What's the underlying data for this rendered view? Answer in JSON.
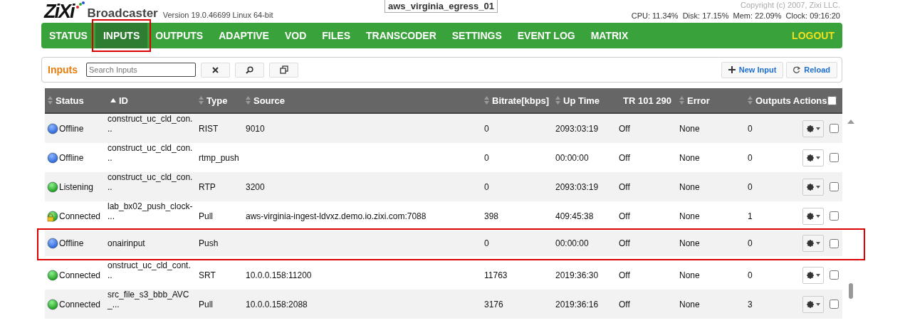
{
  "header": {
    "logo": "ZiXi",
    "product": "Broadcaster",
    "version": "Version 19.0.46699 Linux 64-bit",
    "server_name": "aws_virginia_egress_01",
    "copyright": "Copyright (c) 2007, Zixi LLC.",
    "stats": "CPU: 11.34%  Disk: 17.15%  Mem: 22.09%  Clock: 09:16:20"
  },
  "nav": [
    {
      "label": "STATUS",
      "selected": false,
      "highlighted": false
    },
    {
      "label": "INPUTS",
      "selected": true,
      "highlighted": true
    },
    {
      "label": "OUTPUTS",
      "selected": false,
      "highlighted": false
    },
    {
      "label": "ADAPTIVE",
      "selected": false,
      "highlighted": false
    },
    {
      "label": "VOD",
      "selected": false,
      "highlighted": false
    },
    {
      "label": "FILES",
      "selected": false,
      "highlighted": false
    },
    {
      "label": "TRANSCODER",
      "selected": false,
      "highlighted": false
    },
    {
      "label": "SETTINGS",
      "selected": false,
      "highlighted": false
    },
    {
      "label": "EVENT LOG",
      "selected": false,
      "highlighted": false
    },
    {
      "label": "MATRIX",
      "selected": false,
      "highlighted": false
    }
  ],
  "logout": "LOGOUT",
  "toolbar": {
    "title": "Inputs",
    "search": {
      "placeholder": "Search Inputs"
    },
    "new_button": "New Input",
    "reload_button": "Reload"
  },
  "table": {
    "columns": [
      {
        "label": "Status",
        "sortable": true,
        "sorted_ascending": false
      },
      {
        "label": "ID",
        "sortable": true,
        "sorted_ascending": true
      },
      {
        "label": "Type",
        "sortable": true,
        "sorted_ascending": false
      },
      {
        "label": "Source",
        "sortable": true,
        "sorted_ascending": false
      },
      {
        "label": "Bitrate[kbps]",
        "sortable": true,
        "sorted_ascending": false
      },
      {
        "label": "Up Time",
        "sortable": true,
        "sorted_ascending": false
      },
      {
        "label": "TR 101 290",
        "sortable": false
      },
      {
        "label": "Error",
        "sortable": true,
        "sorted_ascending": false
      },
      {
        "label": "Outputs",
        "sortable": true,
        "sorted_ascending": false
      },
      {
        "label": "Actions",
        "sortable": false
      }
    ],
    "select_all": {
      "checked": false
    },
    "rows": [
      {
        "kind": "offline",
        "status": "Offline",
        "id": "construct_uc_cld_con.\n..",
        "type": "RIST",
        "source": "9010",
        "bitrate": "0",
        "uptime": "2093:03:19",
        "tr": "Off",
        "error": "None",
        "outputs": "0",
        "checked": false,
        "highlighted": false
      },
      {
        "kind": "offline",
        "status": "Offline",
        "id": "construct_uc_cld_con.\n..",
        "type": "rtmp_push",
        "source": "",
        "bitrate": "0",
        "uptime": "00:00:00",
        "tr": "Off",
        "error": "None",
        "outputs": "0",
        "checked": false,
        "highlighted": false
      },
      {
        "kind": "online",
        "status": "Listening",
        "id": "construct_uc_cld_con.\n..",
        "type": "RTP",
        "source": "3200",
        "bitrate": "0",
        "uptime": "2093:03:19",
        "tr": "Off",
        "error": "None",
        "outputs": "0",
        "checked": false,
        "highlighted": false
      },
      {
        "kind": "secure",
        "status": "Connected",
        "id": "lab_bx02_push_clock-\n...",
        "type": "Pull",
        "source": "aws-virginia-ingest-ldvxz.demo.io.zixi.com:7088",
        "bitrate": "398",
        "uptime": "409:45:38",
        "tr": "Off",
        "error": "None",
        "outputs": "1",
        "checked": false,
        "highlighted": false
      },
      {
        "kind": "offline",
        "status": "Offline",
        "id": "onairinput",
        "type": "Push",
        "source": "",
        "bitrate": "0",
        "uptime": "00:00:00",
        "tr": "Off",
        "error": "None",
        "outputs": "0",
        "checked": false,
        "highlighted": true
      },
      {
        "kind": "online",
        "status": "Connected",
        "id": "onstruct_uc_cld_cont.\n..",
        "type": "SRT",
        "source": "10.0.0.158:11200",
        "bitrate": "11763",
        "uptime": "2019:36:30",
        "tr": "Off",
        "error": "None",
        "outputs": "0",
        "checked": false,
        "highlighted": false
      },
      {
        "kind": "online",
        "status": "Connected",
        "id": "src_file_s3_bbb_AVC\n_...",
        "type": "Pull",
        "source": "10.0.0.158:2088",
        "bitrate": "3176",
        "uptime": "2019:36:16",
        "tr": "Off",
        "error": "None",
        "outputs": "3",
        "checked": false,
        "highlighted": false
      }
    ]
  }
}
